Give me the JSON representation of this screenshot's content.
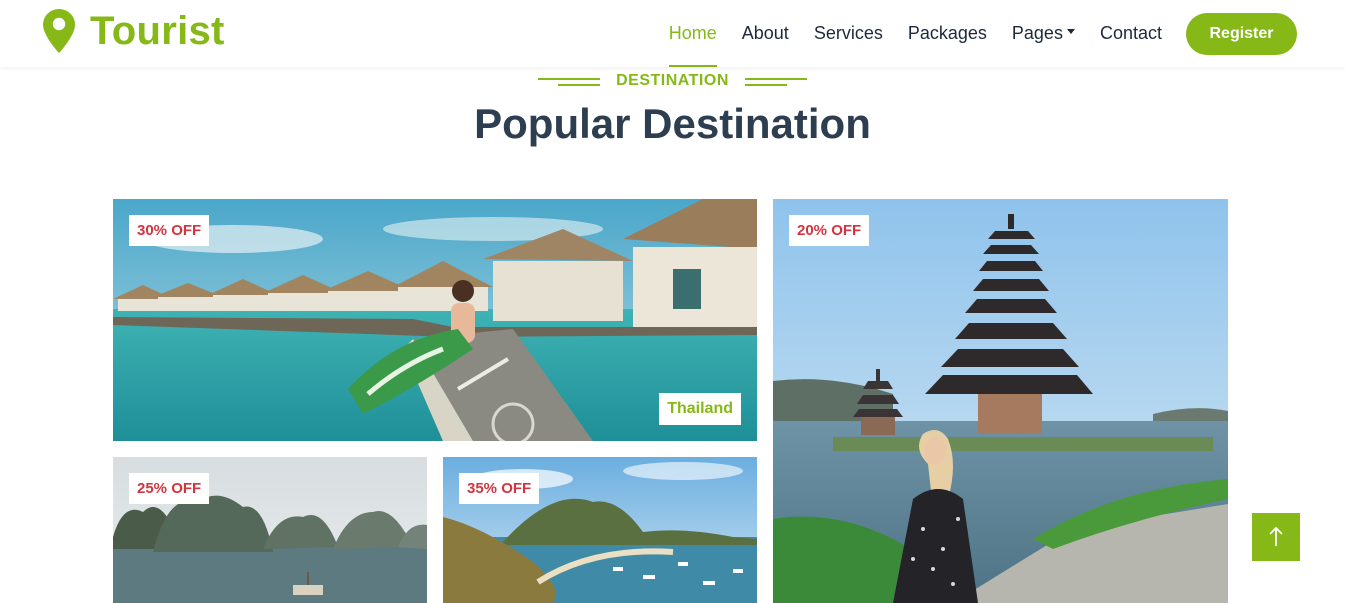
{
  "brand": {
    "name": "Tourist",
    "icon": "map-marker-icon",
    "color": "#86b817"
  },
  "nav": {
    "items": [
      {
        "label": "Home",
        "active": true
      },
      {
        "label": "About",
        "active": false
      },
      {
        "label": "Services",
        "active": false
      },
      {
        "label": "Packages",
        "active": false
      },
      {
        "label": "Pages",
        "active": false,
        "dropdown": true
      },
      {
        "label": "Contact",
        "active": false
      }
    ],
    "register_label": "Register"
  },
  "section": {
    "subtitle": "DESTINATION",
    "title": "Popular Destination"
  },
  "destinations": [
    {
      "badge": "30% OFF",
      "place": "Thailand",
      "scene": "overwater-bungalows-cyclist"
    },
    {
      "badge": "25% OFF",
      "scene": "limestone-islands-bay"
    },
    {
      "badge": "35% OFF",
      "scene": "island-bay-boats"
    },
    {
      "badge": "20% OFF",
      "scene": "lake-temple-pagoda"
    }
  ],
  "colors": {
    "accent": "#86b817",
    "heading": "#2c3e50",
    "discount": "#d4343f"
  },
  "back_to_top": {
    "icon": "arrow-up-icon"
  }
}
